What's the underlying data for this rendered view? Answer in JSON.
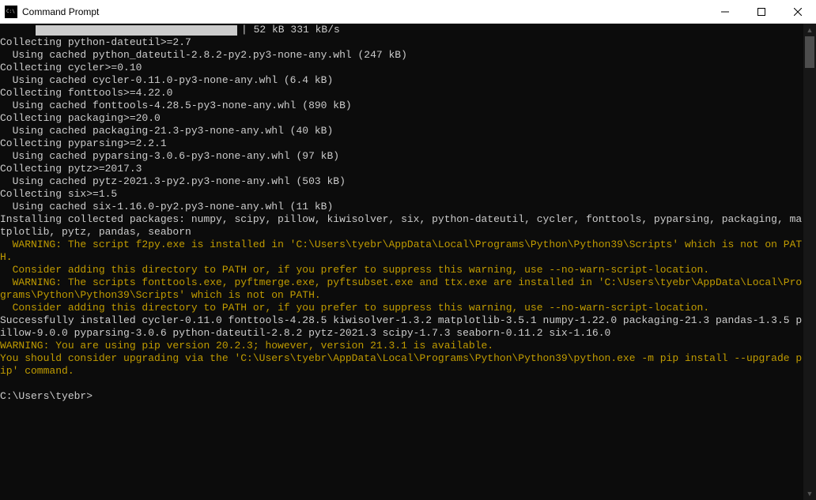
{
  "window": {
    "title": "Command Prompt"
  },
  "progress": {
    "text": "| 52 kB 331 kB/s"
  },
  "lines": [
    {
      "cls": "",
      "t": "Collecting python-dateutil>=2.7"
    },
    {
      "cls": "",
      "t": "  Using cached python_dateutil-2.8.2-py2.py3-none-any.whl (247 kB)"
    },
    {
      "cls": "",
      "t": "Collecting cycler>=0.10"
    },
    {
      "cls": "",
      "t": "  Using cached cycler-0.11.0-py3-none-any.whl (6.4 kB)"
    },
    {
      "cls": "",
      "t": "Collecting fonttools>=4.22.0"
    },
    {
      "cls": "",
      "t": "  Using cached fonttools-4.28.5-py3-none-any.whl (890 kB)"
    },
    {
      "cls": "",
      "t": "Collecting packaging>=20.0"
    },
    {
      "cls": "",
      "t": "  Using cached packaging-21.3-py3-none-any.whl (40 kB)"
    },
    {
      "cls": "",
      "t": "Collecting pyparsing>=2.2.1"
    },
    {
      "cls": "",
      "t": "  Using cached pyparsing-3.0.6-py3-none-any.whl (97 kB)"
    },
    {
      "cls": "",
      "t": "Collecting pytz>=2017.3"
    },
    {
      "cls": "",
      "t": "  Using cached pytz-2021.3-py2.py3-none-any.whl (503 kB)"
    },
    {
      "cls": "",
      "t": "Collecting six>=1.5"
    },
    {
      "cls": "",
      "t": "  Using cached six-1.16.0-py2.py3-none-any.whl (11 kB)"
    },
    {
      "cls": "",
      "t": "Installing collected packages: numpy, scipy, pillow, kiwisolver, six, python-dateutil, cycler, fonttools, pyparsing, packaging, matplotlib, pytz, pandas, seaborn"
    },
    {
      "cls": "yellow",
      "t": "  WARNING: The script f2py.exe is installed in 'C:\\Users\\tyebr\\AppData\\Local\\Programs\\Python\\Python39\\Scripts' which is not on PATH."
    },
    {
      "cls": "yellow",
      "t": "  Consider adding this directory to PATH or, if you prefer to suppress this warning, use --no-warn-script-location."
    },
    {
      "cls": "yellow",
      "t": "  WARNING: The scripts fonttools.exe, pyftmerge.exe, pyftsubset.exe and ttx.exe are installed in 'C:\\Users\\tyebr\\AppData\\Local\\Programs\\Python\\Python39\\Scripts' which is not on PATH."
    },
    {
      "cls": "yellow",
      "t": "  Consider adding this directory to PATH or, if you prefer to suppress this warning, use --no-warn-script-location."
    },
    {
      "cls": "",
      "t": "Successfully installed cycler-0.11.0 fonttools-4.28.5 kiwisolver-1.3.2 matplotlib-3.5.1 numpy-1.22.0 packaging-21.3 pandas-1.3.5 pillow-9.0.0 pyparsing-3.0.6 python-dateutil-2.8.2 pytz-2021.3 scipy-1.7.3 seaborn-0.11.2 six-1.16.0"
    },
    {
      "cls": "yellow",
      "t": "WARNING: You are using pip version 20.2.3; however, version 21.3.1 is available."
    },
    {
      "cls": "yellow",
      "t": "You should consider upgrading via the 'C:\\Users\\tyebr\\AppData\\Local\\Programs\\Python\\Python39\\python.exe -m pip install --upgrade pip' command."
    },
    {
      "cls": "",
      "t": ""
    },
    {
      "cls": "",
      "t": "C:\\Users\\tyebr>"
    }
  ]
}
